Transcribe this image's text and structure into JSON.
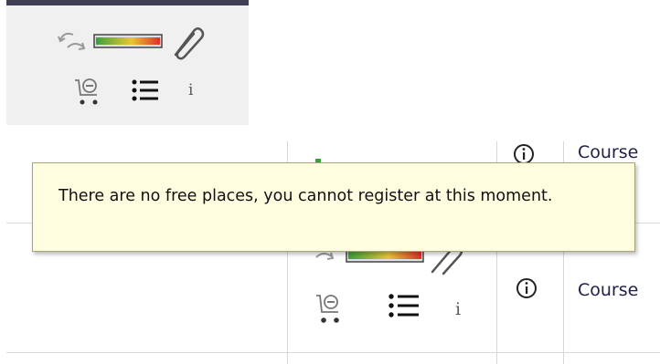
{
  "tooltip": {
    "text": "There are no free places, you cannot register at this moment."
  },
  "rows": [
    {
      "course_label": "Course"
    },
    {
      "course_label": "Course"
    }
  ],
  "icons": {
    "undo_redo": "undo-redo-icon",
    "rating_bar": "rating-gradient-bar",
    "attachment": "paperclip-icon",
    "cart_remove": "cart-remove-icon",
    "list": "list-icon",
    "info_letter": "info-letter-icon",
    "info_circle": "info-circle-icon"
  },
  "info_letter": "i",
  "colors": {
    "panel_border": "#3f3e54",
    "tooltip_bg": "#fffde0",
    "text": "#1f1f4a"
  }
}
